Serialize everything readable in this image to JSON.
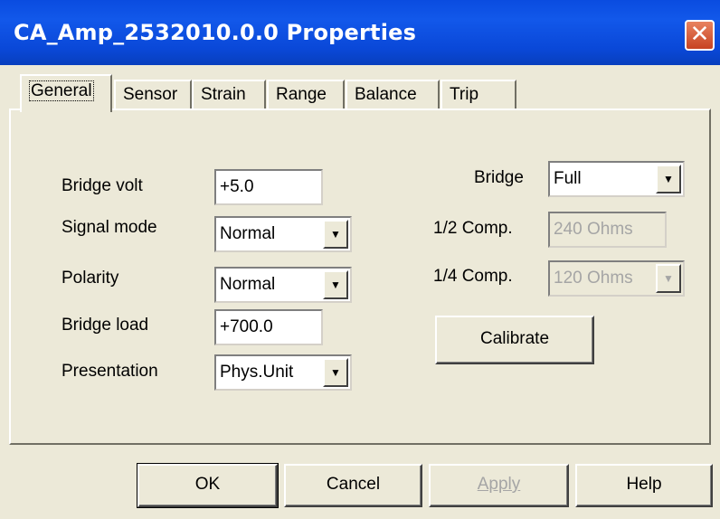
{
  "window": {
    "title": "CA_Amp_2532010.0.0 Properties",
    "close_icon": "close-icon"
  },
  "tabs": [
    {
      "label": "General"
    },
    {
      "label": "Sensor"
    },
    {
      "label": "Strain"
    },
    {
      "label": "Range"
    },
    {
      "label": "Balance"
    },
    {
      "label": "Trip"
    }
  ],
  "general": {
    "bridge_volt": {
      "label": "Bridge volt",
      "value": "+5.0"
    },
    "signal_mode": {
      "label": "Signal mode",
      "value": "Normal"
    },
    "polarity": {
      "label": "Polarity",
      "value": "Normal"
    },
    "bridge_load": {
      "label": "Bridge load",
      "value": "+700.0"
    },
    "presentation": {
      "label": "Presentation",
      "value": "Phys.Unit"
    },
    "bridge": {
      "label": "Bridge",
      "value": "Full"
    },
    "half_comp": {
      "label": "1/2 Comp.",
      "value": "240 Ohms"
    },
    "quarter_comp": {
      "label": "1/4 Comp.",
      "value": "120 Ohms"
    },
    "calibrate_label": "Calibrate",
    "dropdown_arrow": "▼"
  },
  "footer": {
    "ok_label": "OK",
    "cancel_label": "Cancel",
    "apply_label": "Apply",
    "help_label": "Help"
  }
}
